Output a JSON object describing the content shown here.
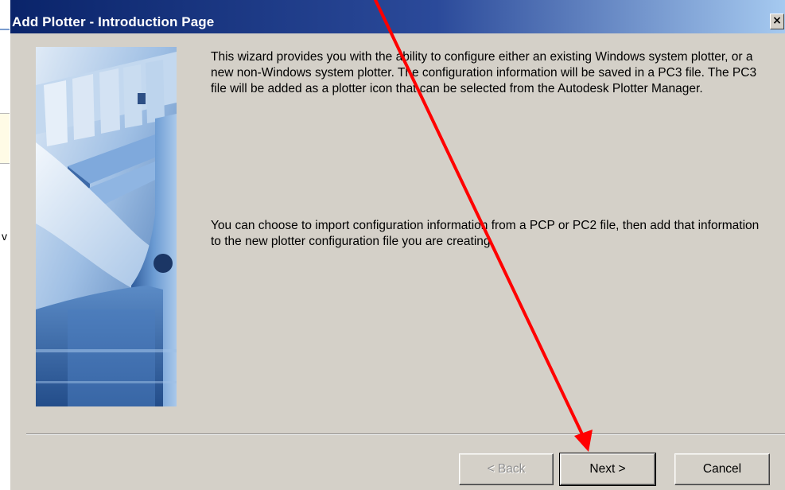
{
  "dialog": {
    "title": "Add Plotter - Introduction Page",
    "close_label": "×",
    "paragraph1": "This wizard provides you with the ability to configure either an existing Windows system plotter, or a new non-Windows system plotter. The configuration information will be saved in a PC3 file. The PC3 file will be added as a plotter icon that can be selected from the Autodesk Plotter Manager.",
    "paragraph2": "You can choose to import configuration information from a PCP or PC2 file, then add that information to the new plotter configuration file you are creating.",
    "buttons": {
      "back": "< Back",
      "next": "Next >",
      "cancel": "Cancel"
    }
  },
  "background_window": {
    "partial_char": "v"
  },
  "annotation": {
    "arrow_color": "#ff0000",
    "target": "next-button"
  },
  "colors": {
    "titlebar_start": "#0a246a",
    "titlebar_end": "#a6caf0",
    "dialog_face": "#d4d0c8"
  },
  "icons": {
    "close": "close-icon",
    "side_image": "plotter-illustration"
  }
}
